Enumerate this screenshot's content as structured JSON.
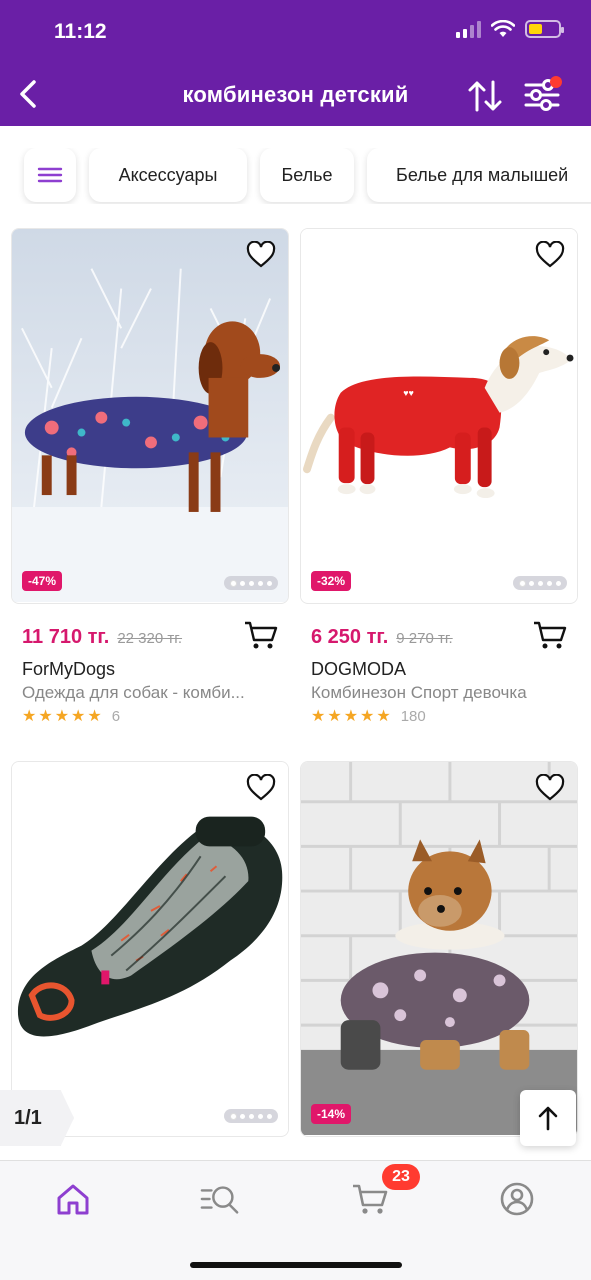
{
  "status_bar": {
    "time": "11:12"
  },
  "header": {
    "title": "комбинезон детский"
  },
  "chips": [
    {
      "label": "Аксессуары"
    },
    {
      "label": "Белье"
    },
    {
      "label": "Белье для малышей"
    }
  ],
  "products": [
    {
      "discount": "-47%",
      "price": "11 710 тг.",
      "old_price": "22 320 тг.",
      "brand": "ForMyDogs",
      "description": "Одежда для собак - комби...",
      "rating": 5,
      "reviews": "6"
    },
    {
      "discount": "-32%",
      "price": "6 250 тг.",
      "old_price": "9 270 тг.",
      "brand": "DOGMODA",
      "description": "Комбинезон  Спорт девочка",
      "rating": 5,
      "reviews": "180"
    },
    {
      "discount": ""
    },
    {
      "discount": "-14%"
    }
  ],
  "pagination": {
    "label": "1/1"
  },
  "bottom_nav": {
    "cart_badge": "23"
  },
  "colors": {
    "brand": "#6a1fa6",
    "price": "#d6186d",
    "star": "#f5a623",
    "badge": "#ff3b30"
  }
}
